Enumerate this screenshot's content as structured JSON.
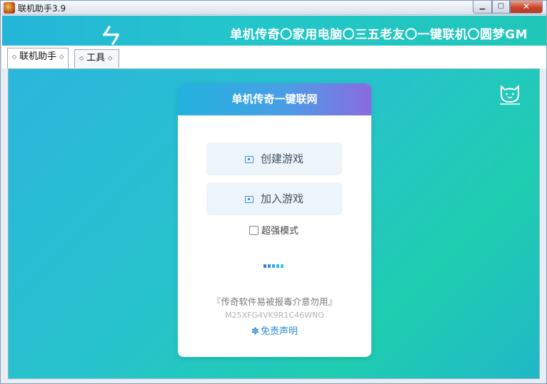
{
  "window": {
    "title": "联机助手3.9",
    "minimize_glyph": "▁",
    "maximize_glyph": "▢",
    "close_glyph": "✕"
  },
  "banner": {
    "logo_text": "ㄣ",
    "slogan": "单机传奇〇家用电脑〇三五老友〇一键联机〇圆梦GM"
  },
  "tabs": [
    {
      "label": "联机助手",
      "active": true
    },
    {
      "label": "工具",
      "active": false
    }
  ],
  "card": {
    "header_title": "单机传奇一键联网",
    "create_button": "创建游戏",
    "join_button": "加入游戏",
    "super_mode_label": "超强模式",
    "super_mode_checked": false,
    "warning_text": "『传奇软件易被报毒介意勿用』",
    "machine_code": "M25XFG4VK9R1C46WNO",
    "disclaimer_label": "免责声明"
  },
  "colors": {
    "accent": "#2f8ed8",
    "banner": "#23c6c9",
    "card_header_start": "#22b3de",
    "card_header_end": "#8a6be0"
  },
  "icons": {
    "app": "app-icon",
    "cat": "cat-face-icon",
    "create": "monitor-icon",
    "join": "monitor-icon",
    "disclaimer": "flower-icon"
  }
}
